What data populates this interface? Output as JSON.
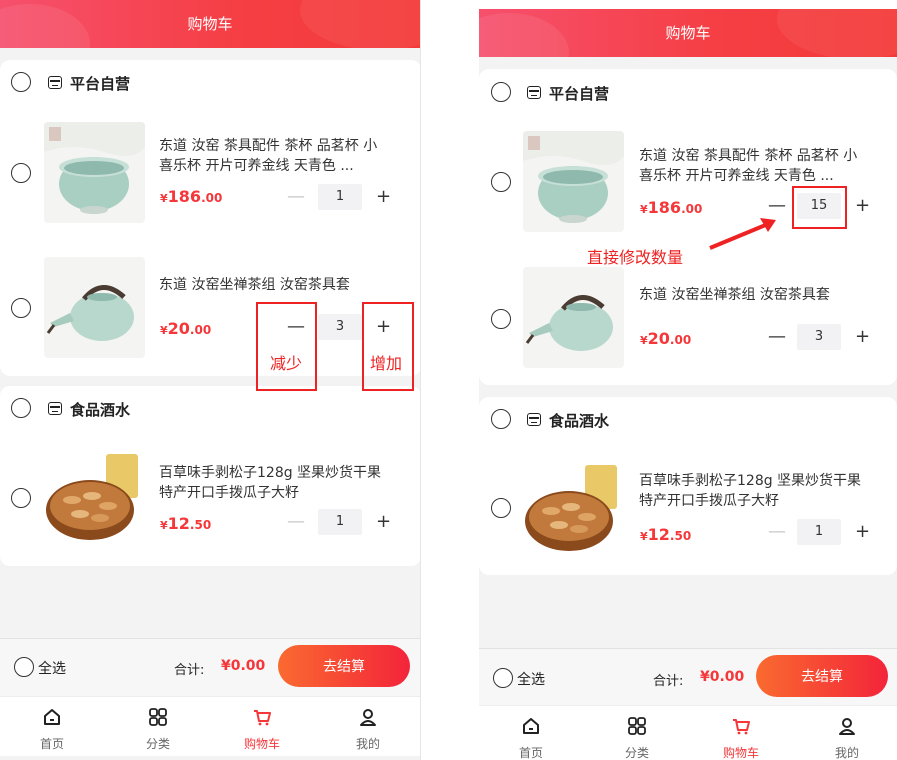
{
  "header": {
    "title": "购物车"
  },
  "shops": [
    {
      "name": "平台自营"
    },
    {
      "name": "食品酒水"
    }
  ],
  "products": [
    {
      "title": "东道 汝窑 茶具配件 茶杯 品茗杯 小喜乐杯 开片可养金线 天青色 ...",
      "price_yen": "¥",
      "price_int": "186",
      "price_dec": ".00",
      "qty_left": "1",
      "qty_right": "15"
    },
    {
      "title": "东道 汝窑坐禅茶组 汝窑茶具套",
      "price_yen": "¥",
      "price_int": "20",
      "price_dec": ".00",
      "qty_left": "3",
      "qty_right": "3"
    },
    {
      "title": "百草味手剥松子128g 坚果炒货干果特产开口手拨瓜子大籽",
      "price_yen": "¥",
      "price_int": "12",
      "price_dec": ".50",
      "qty_left": "1",
      "qty_right": "1"
    }
  ],
  "controls": {
    "minus": "—",
    "plus": "+"
  },
  "checkout": {
    "select_all": "全选",
    "total_label": "合计:",
    "total_value": "¥0.00",
    "button": "去结算"
  },
  "tabs": [
    {
      "label": "首页",
      "icon": "home-icon"
    },
    {
      "label": "分类",
      "icon": "category-icon"
    },
    {
      "label": "购物车",
      "icon": "cart-icon"
    },
    {
      "label": "我的",
      "icon": "profile-icon"
    }
  ],
  "annotations": {
    "decrease": "减少",
    "increase": "增加",
    "edit_qty": "直接修改数量"
  },
  "colors": {
    "accent": "#f5373a",
    "annotation": "#ee2222",
    "header_start": "#f6506d",
    "header_end": "#f43a38"
  }
}
